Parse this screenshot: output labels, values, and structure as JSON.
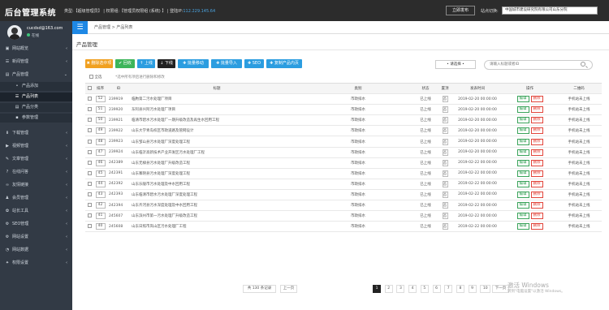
{
  "header": {
    "title": "后台管理系统",
    "info_prefix": "类型:【超级管理员】 | 权限组:【管理员权限组 (系统) 】 | 登陆IP:",
    "ip": "112.229.145.64",
    "publish_label": "立即发布",
    "site_label": "站点切换:",
    "site_value": "中国城市建设研究院有限公司山东分院"
  },
  "sidebar": {
    "user": {
      "name": "cucdsd@163.com",
      "status": "在线"
    },
    "items": [
      {
        "label": "网站概览",
        "icon": "▣",
        "arrow": "‹"
      },
      {
        "label": "新闻管理",
        "icon": "☰",
        "arrow": "‹"
      },
      {
        "label": "产品管理",
        "icon": "▤",
        "arrow": "⌄"
      },
      {
        "label": "产品添加",
        "icon": "•",
        "sub": true
      },
      {
        "label": "产品列表",
        "icon": "☰",
        "sub": true,
        "active": true
      },
      {
        "label": "产品分类",
        "icon": "▤",
        "sub": true
      },
      {
        "label": "参数管理",
        "icon": "▪",
        "sub": true
      },
      {
        "label": "下载管理",
        "icon": "⬇",
        "arrow": "‹"
      },
      {
        "label": "视频管理",
        "icon": "▶",
        "arrow": "‹"
      },
      {
        "label": "文章管理",
        "icon": "✎",
        "arrow": "‹"
      },
      {
        "label": "在线问答",
        "icon": "?",
        "arrow": "‹"
      },
      {
        "label": "友情链接",
        "icon": "∞",
        "arrow": "‹"
      },
      {
        "label": "会员管理",
        "icon": "♟",
        "arrow": "‹"
      },
      {
        "label": "站长工具",
        "icon": "✿",
        "arrow": "‹"
      },
      {
        "label": "SEO管理",
        "icon": "⚙",
        "arrow": "‹"
      },
      {
        "label": "网站设置",
        "icon": "⚙",
        "arrow": "‹"
      },
      {
        "label": "网站数据",
        "icon": "◔",
        "arrow": "‹"
      },
      {
        "label": "权限设置",
        "icon": "✦",
        "arrow": "‹"
      }
    ]
  },
  "breadcrumb": "产品管理 > 产品列表",
  "page_title": "产品管理",
  "toolbar": {
    "buttons": [
      {
        "label": "✖ 删除选中项",
        "color": "#f0a020",
        "w": 34
      },
      {
        "label": "✔ 回收",
        "color": "#3cb55a",
        "w": 24
      },
      {
        "label": "↑ 上线",
        "color": "#2b9de0",
        "w": 22
      },
      {
        "label": "↓ 下线",
        "color": "#222222",
        "w": 22
      },
      {
        "label": "✚ 批量移动",
        "color": "#2b9de0",
        "w": 38
      },
      {
        "label": "✚ 批量导入",
        "color": "#2b9de0",
        "w": 38
      },
      {
        "label": "✚ SEO",
        "color": "#2b9de0",
        "w": 24
      },
      {
        "label": "✚ 复制产品内页",
        "color": "#2b9de0",
        "w": 44
      }
    ]
  },
  "filter": {
    "sort_label": "• 请选择 •",
    "search_placeholder": "请输入标题或者ID"
  },
  "select_all_label": "全选",
  "tip": "*选中所有项后进行删除和修改",
  "table": {
    "headers": [
      "排序",
      "ID",
      "标题",
      "类别",
      "状态",
      "置顶",
      "发表时间",
      "操作",
      "二维码"
    ],
    "edit_label": "编辑",
    "delete_label": "删除",
    "rows": [
      {
        "sort": "52",
        "id": "239919",
        "title": "临朐第二污水处理厂项目",
        "category": "市政排水",
        "status": "已上线",
        "pin": "否",
        "date": "2019-02-20 00:00:00",
        "qr": "手机站未上线"
      },
      {
        "sort": "51",
        "id": "239920",
        "title": "东阿县兴阿污水处理厂项目",
        "category": "市政排水",
        "status": "已上线",
        "pin": "否",
        "date": "2019-02-20 00:00:00",
        "qr": "手机站未上线"
      },
      {
        "sort": "50",
        "id": "239921",
        "title": "临清市碧水污水处理厂一期升级改造及再生水回用工程",
        "category": "市政排水",
        "status": "已上线",
        "pin": "否",
        "date": "2019-02-20 00:00:00",
        "qr": "手机站未上线"
      },
      {
        "sort": "49",
        "id": "239922",
        "title": "山东大学青岛校区市政道路及管网设计",
        "category": "市政排水",
        "status": "已上线",
        "pin": "否",
        "date": "2019-02-20 00:00:00",
        "qr": "手机站未上线"
      },
      {
        "sort": "48",
        "id": "239923",
        "title": "山东邹山县污水处理厂深度处理工程",
        "category": "市政排水",
        "status": "已上线",
        "pin": "否",
        "date": "2019-02-20 00:00:00",
        "qr": "手机站未上线"
      },
      {
        "sort": "47",
        "id": "239924",
        "title": "山东临沂高新技术产业开发区污水处理厂工程",
        "category": "市政排水",
        "status": "已上线",
        "pin": "否",
        "date": "2019-02-20 00:00:00",
        "qr": "手机站未上线"
      },
      {
        "sort": "46",
        "id": "242389",
        "title": "山东无棣县污水处理厂升级改造工程",
        "category": "市政排水",
        "status": "已上线",
        "pin": "否",
        "date": "2019-02-22 00:00:00",
        "qr": "手机站未上线"
      },
      {
        "sort": "45",
        "id": "242391",
        "title": "山东寨阴县污水处理厂深度处理工程",
        "category": "市政排水",
        "status": "已上线",
        "pin": "否",
        "date": "2019-02-22 00:00:00",
        "qr": "手机站未上线"
      },
      {
        "sort": "44",
        "id": "242392",
        "title": "山东乐陵市污水处理及中水回用工程",
        "category": "市政排水",
        "status": "已上线",
        "pin": "否",
        "date": "2019-02-22 00:00:00",
        "qr": "手机站未上线"
      },
      {
        "sort": "43",
        "id": "242393",
        "title": "山东临清市碧水污水处理厂深度处理工程",
        "category": "市政排水",
        "status": "已上线",
        "pin": "否",
        "date": "2019-02-22 00:00:00",
        "qr": "手机站未上线"
      },
      {
        "sort": "42",
        "id": "242394",
        "title": "山东齐河县污水深度处理及中水回用工程",
        "category": "市政排水",
        "status": "已上线",
        "pin": "否",
        "date": "2019-02-22 00:00:00",
        "qr": "手机站未上线"
      },
      {
        "sort": "41",
        "id": "245607",
        "title": "山东滨州市第一污水处理厂升级改造工程",
        "category": "市政排水",
        "status": "已上线",
        "pin": "否",
        "date": "2019-02-22 00:00:00",
        "qr": "手机站未上线"
      },
      {
        "sort": "40",
        "id": "245608",
        "title": "山东日照市岚山区污水处理厂工程",
        "category": "市政排水",
        "status": "已上线",
        "pin": "否",
        "date": "2019-02-22 00:00:00",
        "qr": "手机站未上线"
      }
    ]
  },
  "pagination": {
    "total": "共 130 条记录",
    "prev": "上一页",
    "next": "下一页",
    "pages": [
      "1",
      "2",
      "3",
      "4",
      "5",
      "6",
      "7",
      "8",
      "9",
      "10"
    ],
    "current": "1"
  },
  "watermark": {
    "line1": "激活 Windows",
    "line2": "转到\"电脑设置\"以激活 Windows。"
  }
}
